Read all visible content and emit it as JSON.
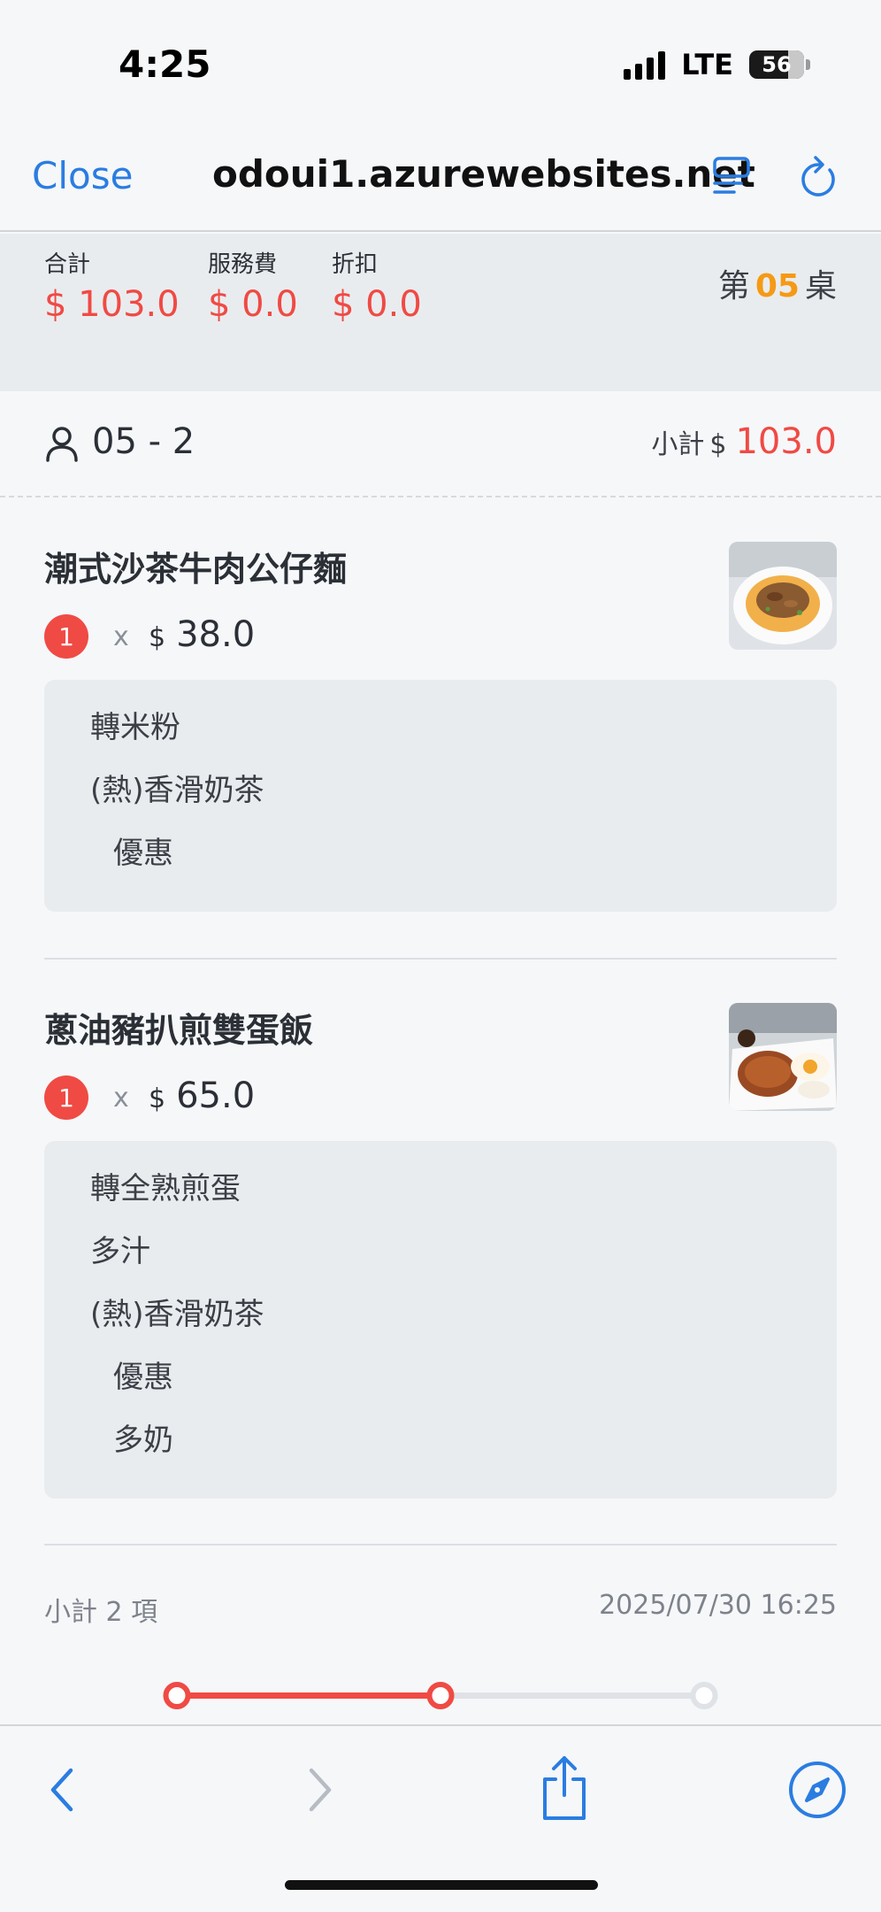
{
  "status_bar": {
    "time": "4:25",
    "network": "LTE",
    "battery_level": "56"
  },
  "browser": {
    "close_label": "Close",
    "url": "odoui1.azurewebsites.net",
    "icons": {
      "reader": "reader-view-icon",
      "reload": "reload-icon"
    }
  },
  "summary": {
    "total_label": "合計",
    "total_value": "$ 103.0",
    "service_label": "服務費",
    "service_value": "$ 0.0",
    "discount_label": "折扣",
    "discount_value": "$ 0.0",
    "table_prefix": "第",
    "table_number": "05",
    "table_suffix": "桌"
  },
  "guest": {
    "label": "05 - 2",
    "subtotal_label": "小計",
    "currency": "$",
    "subtotal_value": "103.0"
  },
  "items": [
    {
      "name": "潮式沙茶牛肉公仔麵",
      "qty": "1",
      "times": "x",
      "currency": "$",
      "price": "38.0",
      "image": "beef-noodle-soup",
      "options": [
        {
          "text": "轉米粉",
          "sub": false
        },
        {
          "text": "(熱)香滑奶茶",
          "sub": false
        },
        {
          "text": "優惠",
          "sub": true
        }
      ]
    },
    {
      "name": "蔥油豬扒煎雙蛋飯",
      "qty": "1",
      "times": "x",
      "currency": "$",
      "price": "65.0",
      "image": "pork-chop-fried-eggs-rice",
      "options": [
        {
          "text": "轉全熟煎蛋",
          "sub": false
        },
        {
          "text": "多汁",
          "sub": false
        },
        {
          "text": "(熱)香滑奶茶",
          "sub": false
        },
        {
          "text": "優惠",
          "sub": true
        },
        {
          "text": "多奶",
          "sub": true
        }
      ]
    }
  ],
  "footer": {
    "count_label": "小計 2 項",
    "timestamp": "2025/07/30 16:25"
  },
  "order_progress": {
    "steps_total": 3,
    "steps_completed": 2,
    "fraction": 0.5
  },
  "colors": {
    "accent_red": "#f04a44",
    "accent_orange": "#f59a16",
    "link_blue": "#2a7de1"
  },
  "toolbar": {
    "icons": [
      "back-icon",
      "forward-icon",
      "share-icon",
      "compass-icon"
    ]
  }
}
